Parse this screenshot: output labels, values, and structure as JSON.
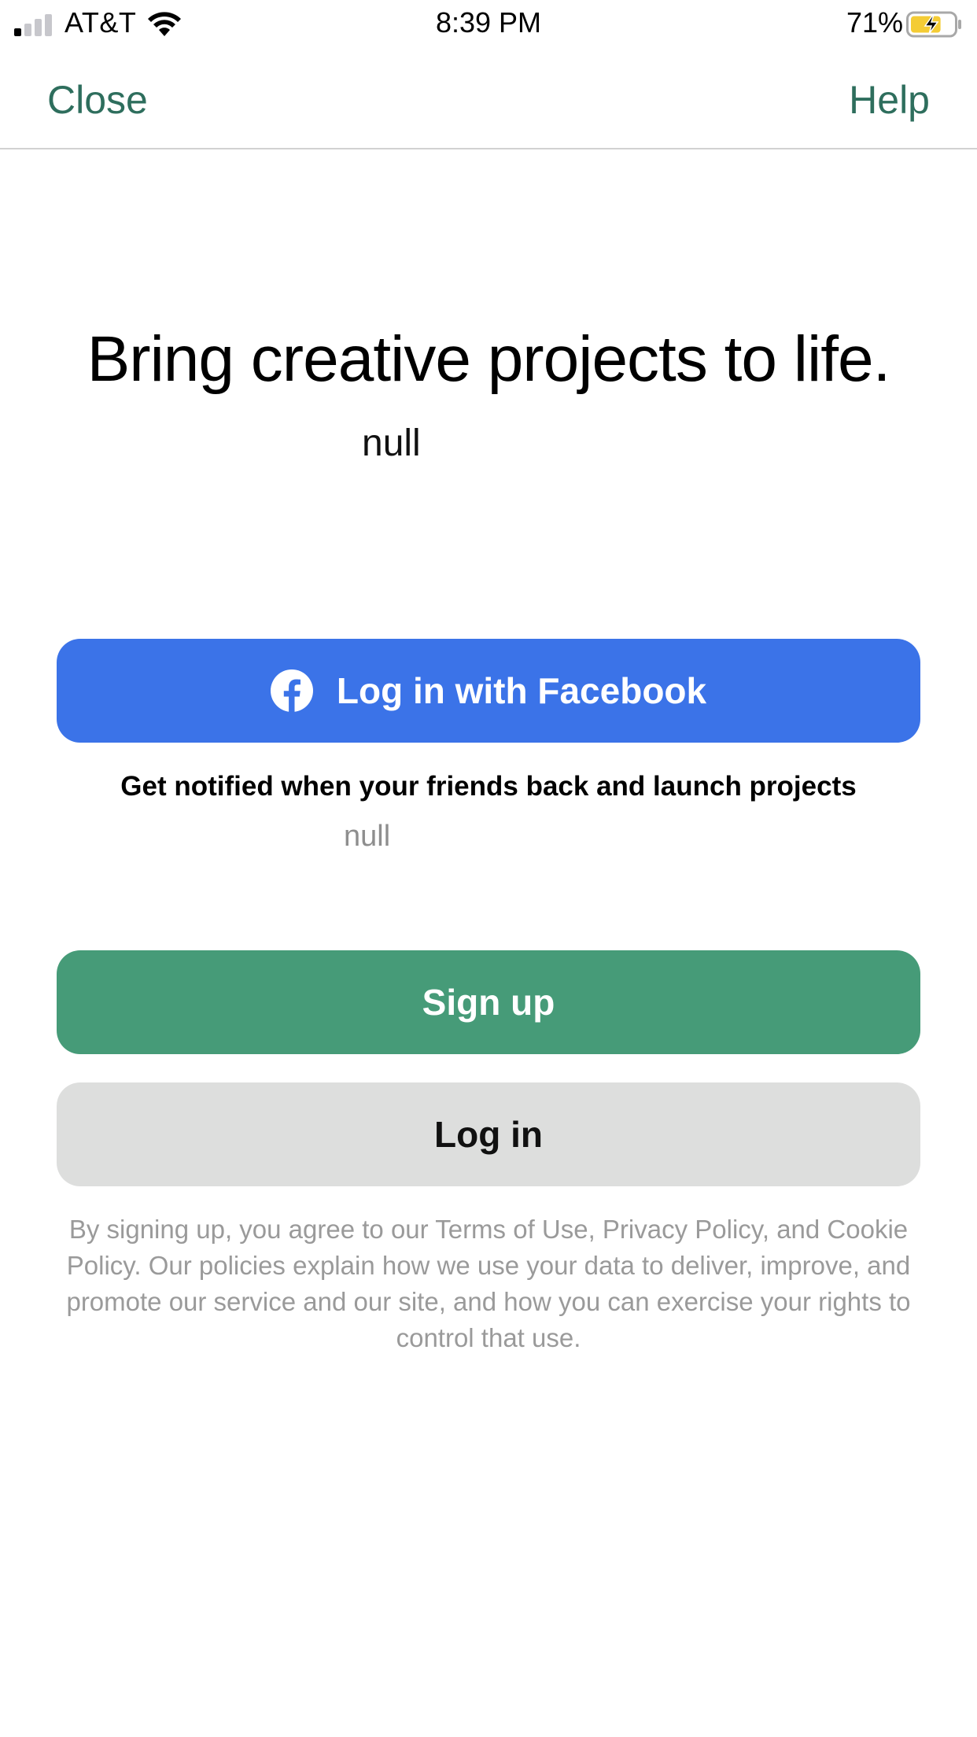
{
  "status_bar": {
    "carrier": "AT&T",
    "time": "8:39 PM",
    "battery_percent": "71%",
    "battery_level": 0.71,
    "charging": true,
    "signal_bars_active": 1,
    "signal_bars_total": 4
  },
  "nav": {
    "close_label": "Close",
    "help_label": "Help",
    "accent_color": "#2e6e5d"
  },
  "hero": {
    "headline": "Bring creative projects to life.",
    "subtitle": "null"
  },
  "facebook": {
    "button_label": "Log in with Facebook",
    "icon": "facebook-icon",
    "color": "#3b73e8",
    "note": "Get notified when your friends back and launch projects",
    "note_subtitle": "null"
  },
  "actions": {
    "signup_label": "Sign up",
    "signup_color": "#469b78",
    "login_label": "Log in",
    "login_color": "#dddedd"
  },
  "legal": {
    "text": "By signing up, you agree to our Terms of Use, Privacy Policy, and Cookie Policy. Our policies explain how we use your data to deliver, improve, and promote our service and our site, and how you can exercise your rights to control that use."
  }
}
